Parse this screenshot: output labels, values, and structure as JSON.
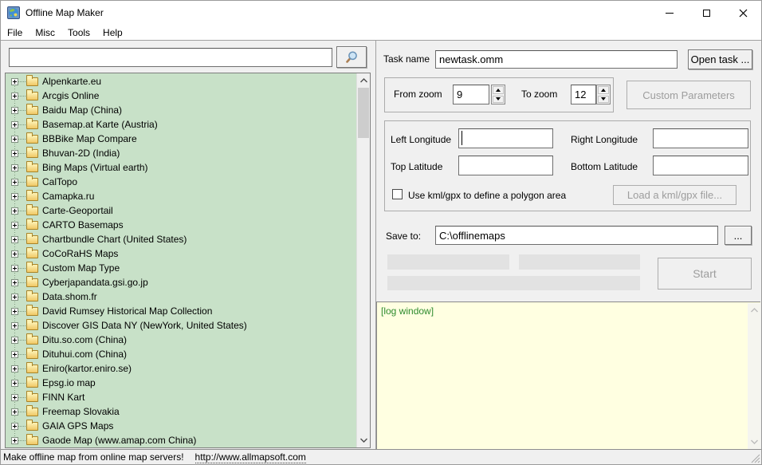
{
  "window": {
    "title": "Offline Map Maker"
  },
  "menu": {
    "items": [
      "File",
      "Misc",
      "Tools",
      "Help"
    ]
  },
  "search": {
    "value": ""
  },
  "map_tree": {
    "items": [
      "Alpenkarte.eu",
      "Arcgis Online",
      "Baidu Map (China)",
      "Basemap.at Karte (Austria)",
      "BBBike Map Compare",
      "Bhuvan-2D (India)",
      "Bing Maps (Virtual earth)",
      "CalTopo",
      "Camapka.ru",
      "Carte-Geoportail",
      "CARTO Basemaps",
      "Chartbundle Chart (United States)",
      "CoCoRaHS Maps",
      "Custom Map Type",
      "Cyberjapandata.gsi.go.jp",
      "Data.shom.fr",
      "David Rumsey Historical Map Collection",
      "Discover GIS Data NY (NewYork, United States)",
      "Ditu.so.com (China)",
      "Dituhui.com (China)",
      "Eniro(kartor.eniro.se)",
      "Epsg.io map",
      "FINN Kart",
      "Freemap Slovakia",
      "GAIA GPS Maps",
      "Gaode Map (www.amap.com China)"
    ]
  },
  "task": {
    "label": "Task name",
    "value": "newtask.omm",
    "open_button": "Open task ..."
  },
  "zoom": {
    "from_label": "From zoom",
    "from_value": "9",
    "to_label": "To zoom",
    "to_value": "12",
    "custom_parameters_button": "Custom Parameters"
  },
  "area": {
    "left_longitude_label": "Left Longitude",
    "left_longitude_value": "",
    "right_longitude_label": "Right Longitude",
    "right_longitude_value": "",
    "top_latitude_label": "Top Latitude",
    "top_latitude_value": "",
    "bottom_latitude_label": "Bottom Latitude",
    "bottom_latitude_value": "",
    "kml_checkbox_label": "Use kml/gpx to define a polygon area",
    "kml_checkbox_checked": false,
    "load_kml_button": "Load a kml/gpx file..."
  },
  "save": {
    "label": "Save to:",
    "path": "C:\\offlinemaps",
    "browse_button": "..."
  },
  "actions": {
    "start_button": "Start"
  },
  "log": {
    "text": "[log window]"
  },
  "status_bar": {
    "message": "Make offline map from online map servers!",
    "link": "http://www.allmapsoft.com"
  },
  "colors": {
    "tree_background": "#c8e1c8",
    "log_background": "#ffffe1",
    "log_text": "#2e8b2e",
    "panel_background": "#f0f0f0",
    "titlebar_background": "#ffffff",
    "folder_icon": "#f0c866",
    "magnifier_lens": "#cde4f5"
  },
  "icons": {
    "app": "globe-map-icon",
    "search": "magnifier-icon",
    "tree_expand": "plus-box-icon",
    "tree_item": "folder-icon",
    "window_controls": [
      "minimize-icon",
      "maximize-icon",
      "close-icon"
    ]
  }
}
